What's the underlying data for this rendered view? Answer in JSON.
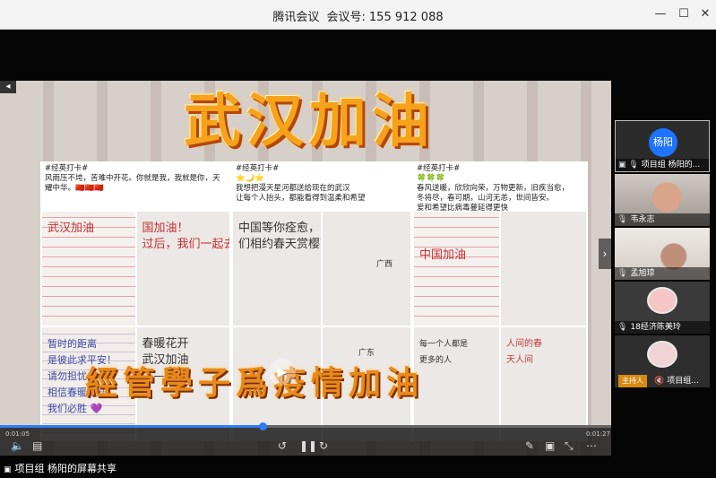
{
  "window": {
    "app_name": "腾讯会议",
    "meeting_id_label": "会议号:",
    "meeting_id": "155 912 088",
    "minimize_icon": "minimize-icon",
    "maximize_icon": "maximize-icon",
    "close_icon": "close-icon"
  },
  "video": {
    "headline": "武汉加油",
    "caption": "經管學子爲疫情加油",
    "panels": [
      {
        "tag": "#经英打卡#",
        "text": "风雨压不垮，苦难中开花。你就是我，我就是你，天耀中华。🇨🇳🇨🇳🇨🇳",
        "photos": [
          "武汉加油",
          "国加油！\n过后，我们一起去武汉",
          "暂时的距离\n是彼此求平安！\n请勿担忧\n相信春暖花开\n我们必胜 💜",
          "春暖花开\n武汉加油\n——祠"
        ]
      },
      {
        "tag": "#经英打卡#",
        "text": "⭐🌙⭐\n我想把漫天星河都送给现在的武汉\n让每个人抬头，都能看得到温柔和希望",
        "photos": [
          "中国等你痊愈，\n们相约春天赏樱花",
          "广西",
          "",
          "广东"
        ]
      },
      {
        "tag": "#经英打卡#",
        "text": "🍀🍀🍀\n春风送暖，欣欣向荣，万物更新，旧疾当愈，\n冬将尽，春可期，山河无恙，世间皆安。\n爱和希望比病毒蔓延得更快",
        "photos": [
          "中国加油",
          "",
          "每一个人都是\n更多的人",
          "人间的春\n天人间"
        ]
      }
    ],
    "time_current": "0:01:05",
    "time_total": "0:01:27",
    "progress": 0.43
  },
  "participants": [
    {
      "name": "项目组 杨阳的...",
      "avatar_text": "杨阳",
      "icon": "screen-share-icon"
    },
    {
      "name": "韦永志",
      "icon": "mic-icon"
    },
    {
      "name": "孟旭琼",
      "icon": "mic-icon"
    },
    {
      "name": "18经济陈美玲",
      "icon": "mic-icon"
    },
    {
      "name": "项目组...",
      "badge": "主持人",
      "icon": "mic-off-icon"
    }
  ],
  "share_label": "项目组 杨阳的屏幕共享",
  "colors": {
    "accent": "#1e73ff",
    "headline": "#f6a21a",
    "host_badge": "#d58a10"
  }
}
